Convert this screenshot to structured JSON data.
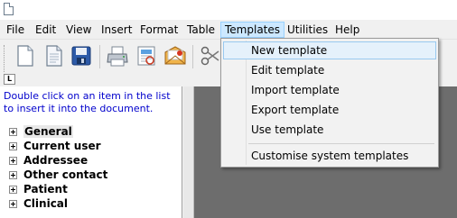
{
  "menubar": {
    "items": [
      "File",
      "Edit",
      "View",
      "Insert",
      "Format",
      "Table",
      "Templates",
      "Utilities",
      "Help"
    ],
    "active": "Templates"
  },
  "templates_menu": {
    "items": [
      "New template",
      "Edit template",
      "Import template",
      "Export template",
      "Use template"
    ],
    "extra": "Customise system templates",
    "highlighted": "New template"
  },
  "toolbar": {
    "icons": [
      "new-document-icon",
      "document-icon",
      "save-icon",
      "print-icon",
      "print-preview-icon",
      "envelope-icon",
      "cut-icon",
      "up-down-arrows-icon"
    ],
    "ruler_label": "L"
  },
  "left_panel": {
    "hint": "Double click on an item in the list to insert it into the document.",
    "tree": [
      "General",
      "Current user",
      "Addressee",
      "Other contact",
      "Patient",
      "Clinical"
    ]
  }
}
